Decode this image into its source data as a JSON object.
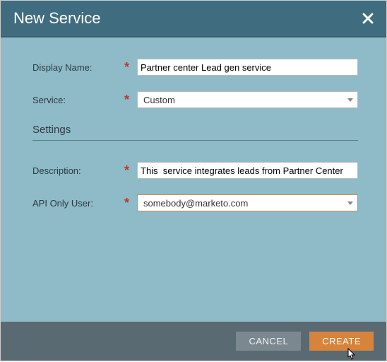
{
  "modal": {
    "title": "New Service",
    "fields": {
      "display_name": {
        "label": "Display Name:",
        "value": "Partner center Lead gen service"
      },
      "service": {
        "label": "Service:",
        "value": "Custom"
      },
      "description": {
        "label": "Description:",
        "value": "This  service integrates leads from Partner Center"
      },
      "api_only_user": {
        "label": "API Only User:",
        "value": "somebody@marketo.com"
      }
    },
    "section_heading": "Settings",
    "required_mark": "*",
    "buttons": {
      "cancel": "CANCEL",
      "create": "CREATE"
    }
  }
}
